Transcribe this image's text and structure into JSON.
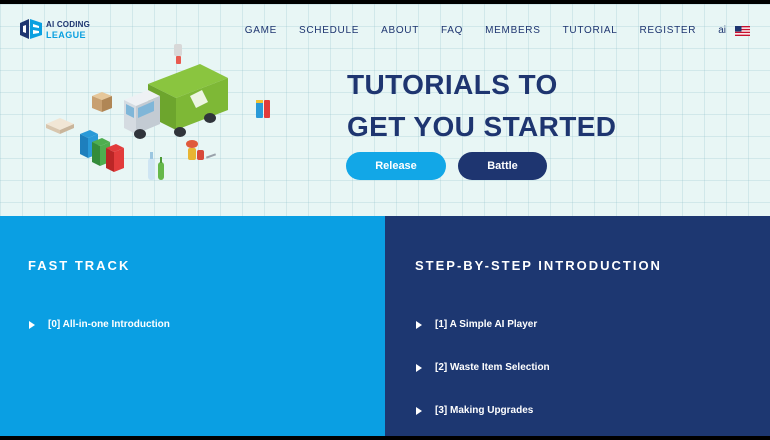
{
  "brand": {
    "line1": "AI CODING",
    "line2": "LEAGUE",
    "logo_icon": "ai-coding-league-logo-icon"
  },
  "nav": {
    "items": [
      "GAME",
      "SCHEDULE",
      "ABOUT",
      "FAQ",
      "MEMBERS",
      "TUTORIAL",
      "REGISTER"
    ],
    "language": "ai",
    "flag_icon": "us-flag-icon"
  },
  "hero": {
    "title_line1": "TUTORIALS TO",
    "title_line2": "GET YOU STARTED",
    "illustration": "garbage-truck-recycling-illustration",
    "buttons": {
      "release": "Release",
      "battle": "Battle"
    }
  },
  "fast_track": {
    "title": "FAST TRACK",
    "links": [
      "[0] All-in-one Introduction"
    ]
  },
  "step_by_step": {
    "title": "STEP-BY-STEP INTRODUCTION",
    "links": [
      "[1] A Simple AI Player",
      "[2] Waste Item Selection",
      "[3] Making Upgrades"
    ]
  },
  "colors": {
    "navy": "#1e3570",
    "sky": "#0a9fe3",
    "hero_bg": "#e8f6f5"
  }
}
